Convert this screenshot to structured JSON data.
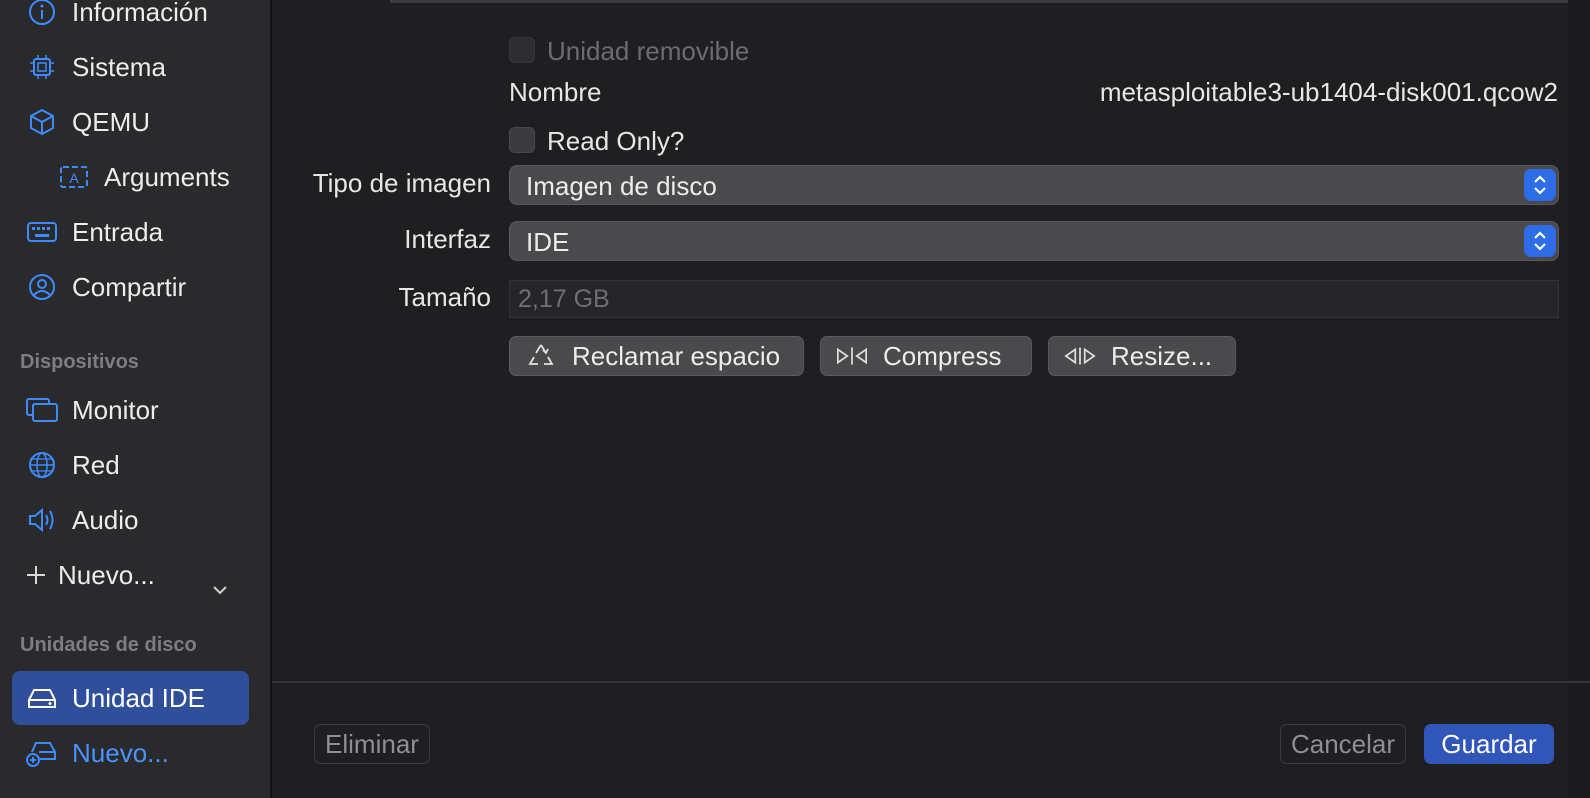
{
  "sidebar": {
    "items": [
      {
        "label": "Información",
        "icon": "info-icon"
      },
      {
        "label": "Sistema",
        "icon": "chip-icon"
      },
      {
        "label": "QEMU",
        "icon": "cube-icon"
      },
      {
        "label": "Arguments",
        "icon": "text-box-icon"
      },
      {
        "label": "Entrada",
        "icon": "keyboard-icon"
      },
      {
        "label": "Compartir",
        "icon": "person-circle-icon"
      }
    ],
    "devices_header": "Dispositivos",
    "devices": [
      {
        "label": "Monitor",
        "icon": "display-icon"
      },
      {
        "label": "Red",
        "icon": "globe-icon"
      },
      {
        "label": "Audio",
        "icon": "speaker-icon"
      }
    ],
    "new_device": "Nuevo...",
    "drives_header": "Unidades de disco",
    "drives": [
      {
        "label": "Unidad IDE",
        "icon": "drive-icon",
        "selected": true
      }
    ],
    "new_drive": "Nuevo..."
  },
  "form": {
    "removable_label": "Unidad removible",
    "name_label": "Nombre",
    "name_value": "metasploitable3-ub1404-disk001.qcow2",
    "readonly_label": "Read Only?",
    "image_type_label": "Tipo de imagen",
    "image_type_value": "Imagen de disco",
    "interface_label": "Interfaz",
    "interface_value": "IDE",
    "size_label": "Tamaño",
    "size_value": "2,17 GB",
    "buttons": {
      "reclaim": "Reclamar espacio",
      "compress": "Compress",
      "resize": "Resize..."
    }
  },
  "footer": {
    "delete": "Eliminar",
    "cancel": "Cancelar",
    "save": "Guardar"
  },
  "colors": {
    "accent": "#2e6ce6",
    "selected_row": "#2f4f9a",
    "icon_blue": "#3c8cff"
  }
}
